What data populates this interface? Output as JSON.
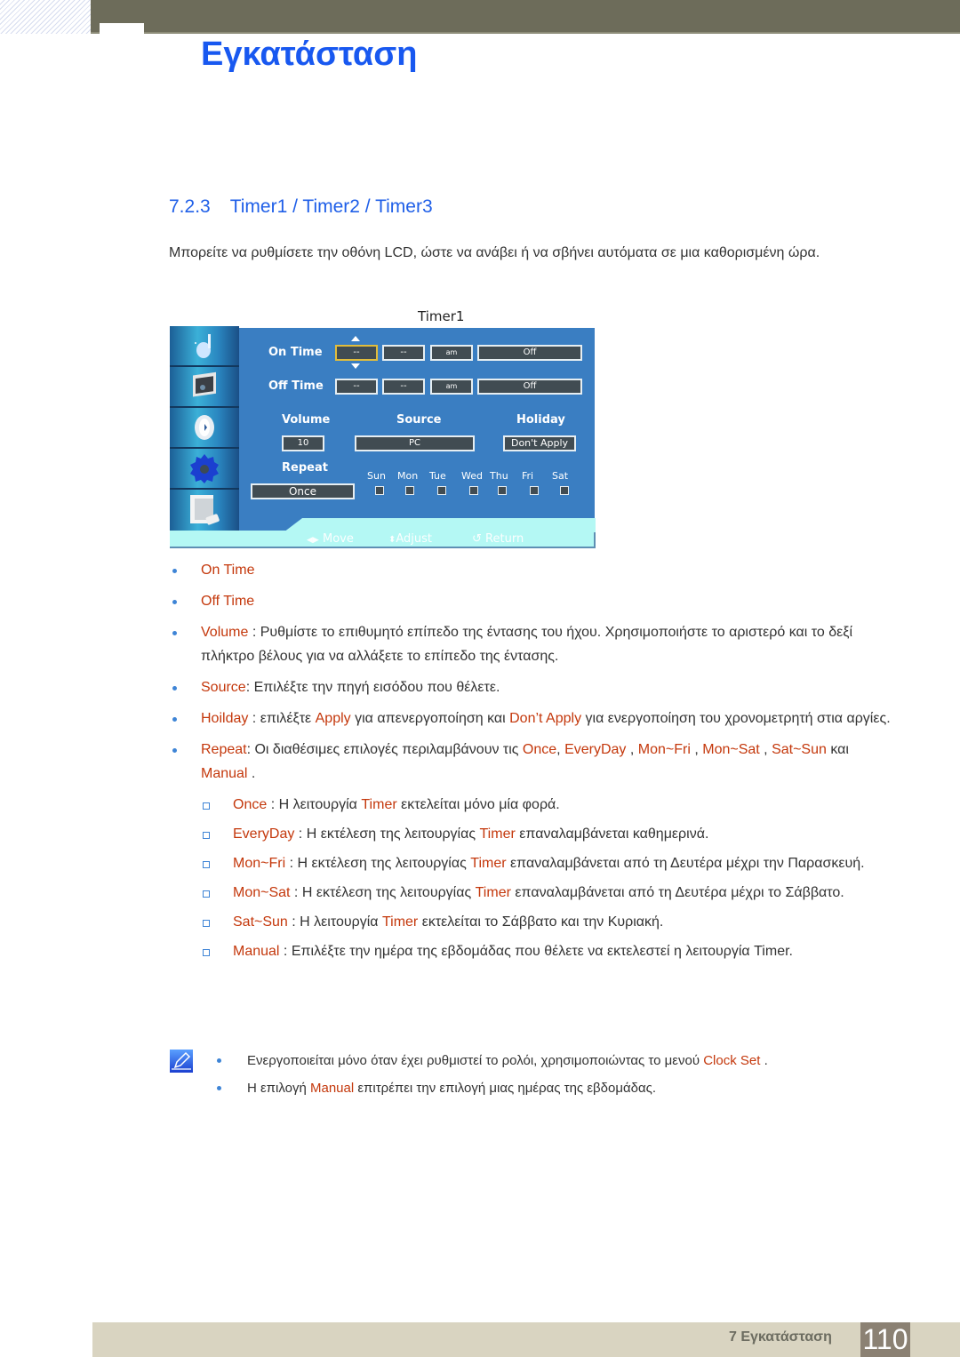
{
  "header": {
    "chapter_title": "Εγκατάσταση"
  },
  "section": {
    "number": "7.2.3",
    "title": "Timer1 / Timer2 / Timer3",
    "intro": "Μπορείτε να ρυθμίσετε την οθόνη LCD, ώστε να ανάβει ή να σβήνει αυτόματα σε μια καθορισμένη ώρα."
  },
  "osd": {
    "title": "Timer1",
    "side_icons": [
      "picture-icon",
      "sound-icon",
      "setup-icon",
      "multi-control-icon",
      "input-icon"
    ],
    "on_time": {
      "label": "On Time",
      "hour": "--",
      "minute": "--",
      "ampm": "am",
      "state": "Off"
    },
    "off_time": {
      "label": "Off Time",
      "hour": "--",
      "minute": "--",
      "ampm": "am",
      "state": "Off"
    },
    "volume": {
      "label": "Volume",
      "value": "10"
    },
    "source": {
      "label": "Source",
      "value": "PC"
    },
    "holiday": {
      "label": "Holiday",
      "value": "Don't Apply"
    },
    "repeat": {
      "label": "Repeat",
      "value": "Once"
    },
    "days": [
      "Sun",
      "Mon",
      "Tue",
      "Wed",
      "Thu",
      "Fri",
      "Sat"
    ],
    "footer": {
      "move": "Move",
      "adjust": "Adjust",
      "return": "Return"
    }
  },
  "bullets": {
    "on_time": "On Time",
    "off_time": "Off Time",
    "volume_key": "Volume",
    "volume_text": " : Ρυθμίστε το επιθυμητό επίπεδο της έντασης του ήχου. Χρησιμοποιήστε το αριστερό και το δεξί πλήκτρο βέλους για να αλλάξετε το επίπεδο της έντασης.",
    "source_key": "Source",
    "source_text": ":  Επιλέξτε την πηγή εισόδου που θέλετε.",
    "holiday_key": "Hoilday",
    "holiday_t1": " :  επιλέξτε ",
    "holiday_apply": "Apply",
    "holiday_t2": "  για απενεργοποίηση και ",
    "holiday_dont": "Don’t Apply",
    "holiday_t3": "   για ενεργοποίηση του χρονομετρητή στια αργίες.",
    "repeat_key": "Repeat",
    "repeat_t1": ": Οι διαθέσιμες επιλογές περιλαμβάνουν τις ",
    "repeat_opts": [
      "Once",
      "EveryDay",
      "Mon~Fri",
      "Mon~Sat",
      "Sat~Sun",
      "Manual"
    ],
    "repeat_and": " και "
  },
  "sub_items": [
    {
      "key": "Once",
      "t1": " : Η λειτουργία ",
      "timer": "Timer",
      "t2": "  εκτελείται μόνο μία φορά."
    },
    {
      "key": "EveryDay",
      "t1": "  : Η εκτέλεση της λειτουργίας ",
      "timer": "Timer",
      "t2": "  επαναλαμβάνεται καθημερινά."
    },
    {
      "key": "Mon~Fri",
      "t1": "  : Η εκτέλεση της λειτουργίας ",
      "timer": "Timer",
      "t2": "  επαναλαμβάνεται από τη Δευτέρα μέχρι την Παρασκευή."
    },
    {
      "key": "Mon~Sat",
      "t1": "  : Η εκτέλεση της λειτουργίας ",
      "timer": "Timer",
      "t2": "  επαναλαμβάνεται από τη Δευτέρα μέχρι το Σάββατο."
    },
    {
      "key": "Sat~Sun",
      "t1": "  : Η λειτουργία ",
      "timer": "Timer",
      "t2": "  εκτελείται το Σάββατο και την Κυριακή."
    },
    {
      "key": "Manual",
      "t1": " : Επιλέξτε την ημέρα της εβδομάδας που θέλετε να εκτελεστεί η λειτουργία Timer.",
      "timer": "",
      "t2": ""
    }
  ],
  "notes": {
    "n1_text": "Ενεργοποιείται μόνο όταν έχει ρυθμιστεί το ρολόι, χρησιμοποιώντας το μενού ",
    "n1_key": "Clock Set",
    "n1_end": " .",
    "n2_t1": "Η επιλογή ",
    "n2_key": "Manual",
    "n2_t2": "  επιτρέπει την επιλογή μιας ημέρας της εβδομάδας."
  },
  "footer": {
    "chapter_label": "7 Εγκατάσταση",
    "page_number": "110"
  },
  "colors": {
    "accent_blue": "#1858f0",
    "highlight_orange": "#c4380c",
    "osd_blue": "#3a7ec2"
  }
}
